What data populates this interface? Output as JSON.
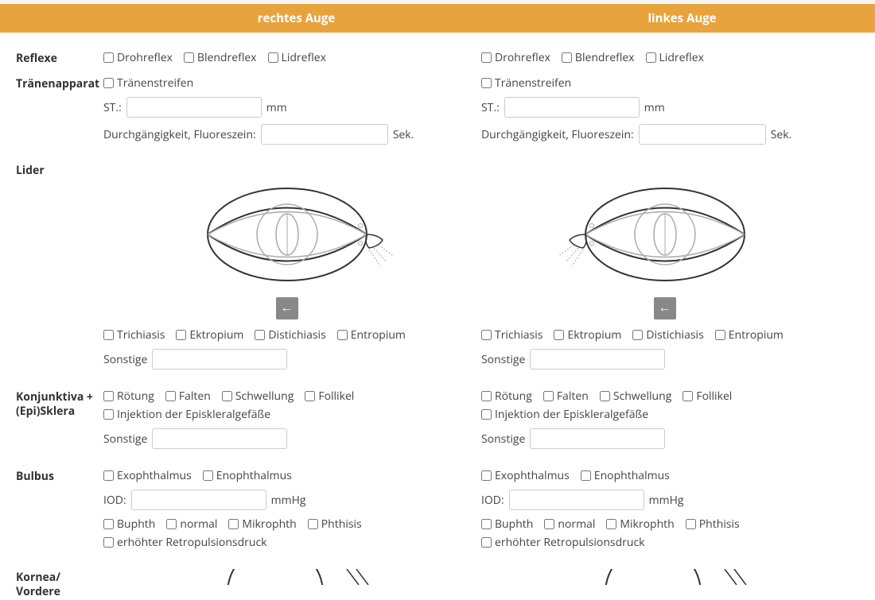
{
  "header": {
    "right": "rechtes Auge",
    "left": "linkes Auge"
  },
  "labels": {
    "reflexe": "Reflexe",
    "traenen": "Tränenapparat",
    "lider": "Lider",
    "konj": "Konjunktiva + (Epi)Sklera",
    "bulbus": "Bulbus",
    "kornea": "Kornea/ Vordere"
  },
  "reflexe": {
    "droh": "Drohreflex",
    "blend": "Blendreflex",
    "lid": "Lidreflex"
  },
  "traenen": {
    "streifen": "Tränenstreifen",
    "st": "ST.:",
    "mm": "mm",
    "durch": "Durchgängigkeit, Fluoreszein:",
    "sek": "Sek."
  },
  "lider": {
    "trich": "Trichiasis",
    "ektro": "Ektropium",
    "dist": "Distichiasis",
    "entro": "Entropium",
    "sonst": "Sonstige"
  },
  "konj": {
    "roet": "Rötung",
    "falten": "Falten",
    "schwell": "Schwellung",
    "follik": "Follikel",
    "inj": "Injektion der Episkleralgefäße",
    "sonst": "Sonstige"
  },
  "bulbus": {
    "exo": "Exophthalmus",
    "eno": "Enophthalmus",
    "iod": "IOD:",
    "mmhg": "mmHg",
    "buph": "Buphth",
    "normal": "normal",
    "mikro": "Mikrophth",
    "phthisis": "Phthisis",
    "retro": "erhöhter Retropulsionsdruck"
  },
  "arrow": "←"
}
